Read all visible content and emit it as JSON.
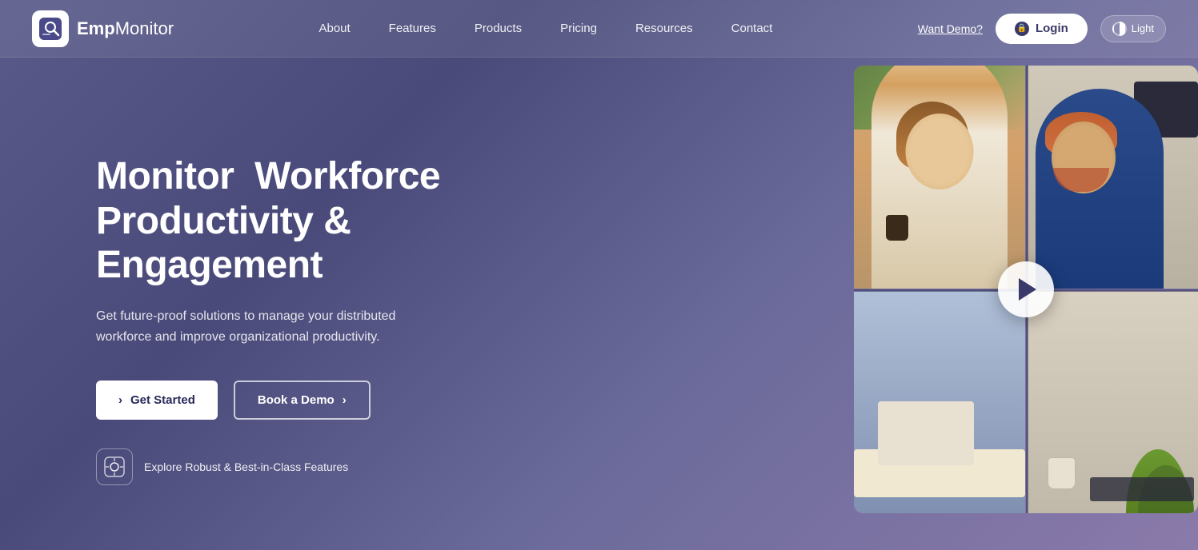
{
  "brand": {
    "name_part1": "Emp",
    "name_part2": "Monitor",
    "logo_alt": "EmpMonitor Logo"
  },
  "nav": {
    "links": [
      {
        "label": "About",
        "href": "#"
      },
      {
        "label": "Features",
        "href": "#"
      },
      {
        "label": "Products",
        "href": "#"
      },
      {
        "label": "Pricing",
        "href": "#"
      },
      {
        "label": "Resources",
        "href": "#"
      },
      {
        "label": "Contact",
        "href": "#"
      }
    ],
    "want_demo": "Want Demo?",
    "login_label": "Login",
    "theme_label": "Light"
  },
  "hero": {
    "title": "Monitor  Workforce\nProductivity & Engagement",
    "subtitle": "Get future-proof solutions to manage your distributed workforce and improve organizational productivity.",
    "btn_get_started": "Get Started",
    "btn_book_demo": "Book a Demo",
    "features_text": "Explore Robust & Best-in-Class Features"
  },
  "colors": {
    "bg_start": "#5a5a8a",
    "bg_end": "#8a7aaa",
    "accent": "#3a3a6a",
    "white": "#ffffff"
  }
}
